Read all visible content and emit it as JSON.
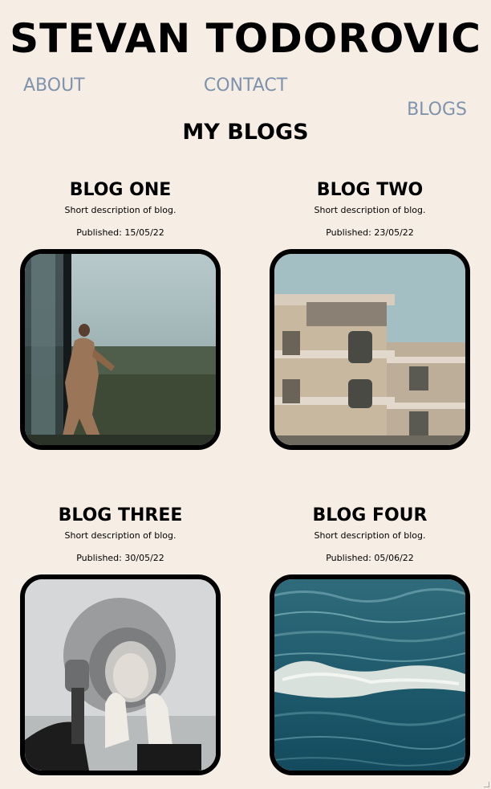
{
  "header": {
    "title": "STEVAN TODOROVIC"
  },
  "nav": {
    "about": "ABOUT",
    "contact": "CONTACT",
    "blogs": "BLOGS"
  },
  "page": {
    "heading": "MY BLOGS"
  },
  "colors": {
    "background": "#f6ede4",
    "nav": "#7e93ad",
    "text": "#000000"
  },
  "blogs": [
    {
      "title": "BLOG ONE",
      "description": "Short description of blog.",
      "published": "Published: 15/05/22",
      "image": "woman-at-window-photo"
    },
    {
      "title": "BLOG TWO",
      "description": "Short description of blog.",
      "published": "Published: 23/05/22",
      "image": "apartment-building-photo"
    },
    {
      "title": "BLOG THREE",
      "description": "Short description of blog.",
      "published": "Published: 30/05/22",
      "image": "astronaut-helmet-photo"
    },
    {
      "title": "BLOG FOUR",
      "description": "Short description of blog.",
      "published": "Published: 05/06/22",
      "image": "ocean-waves-photo"
    }
  ]
}
